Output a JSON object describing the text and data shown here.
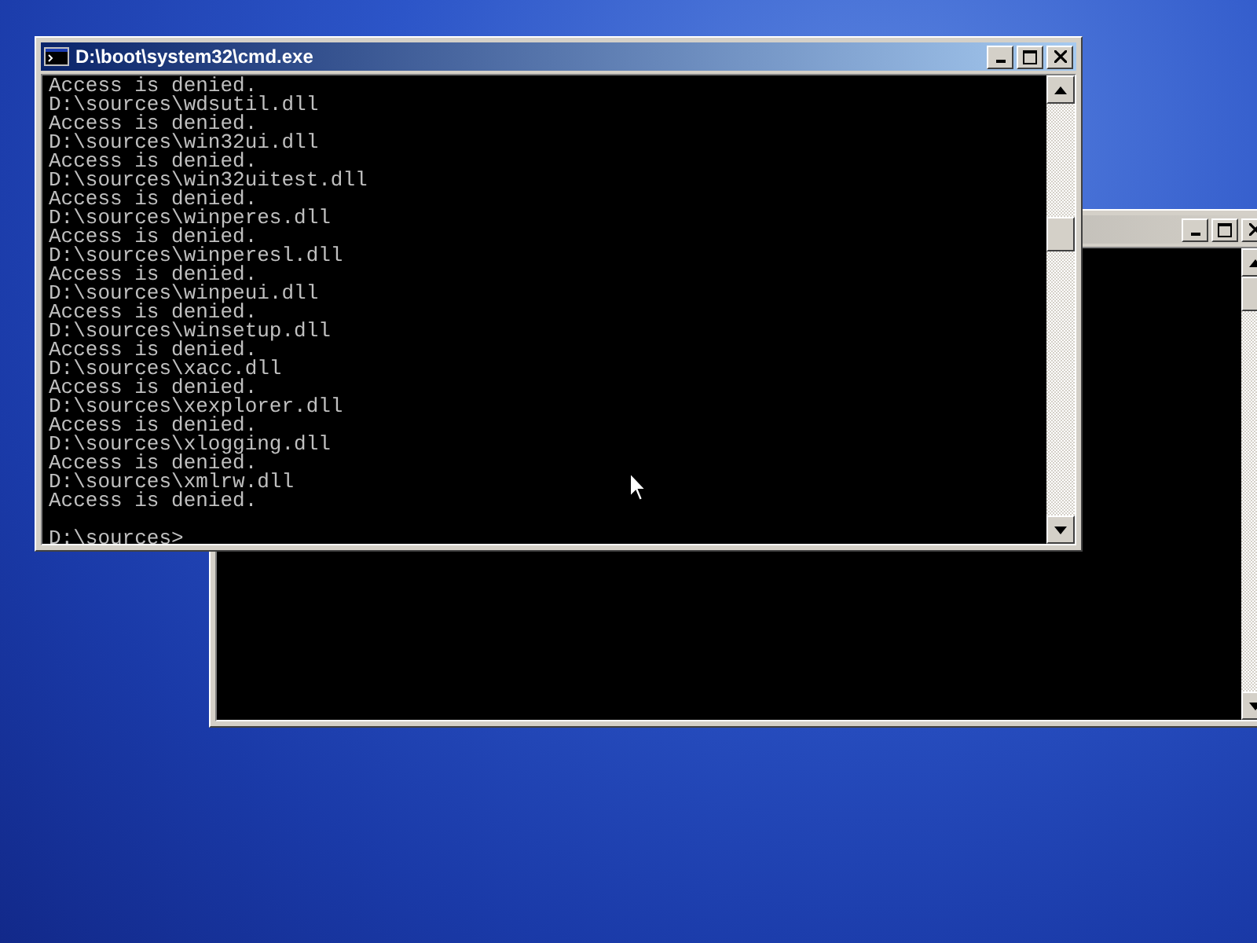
{
  "windows": [
    {
      "active": false
    },
    {
      "active": true,
      "title": "D:\\boot\\system32\\cmd.exe",
      "lines": [
        "Access is denied.",
        "D:\\sources\\wdsutil.dll",
        "Access is denied.",
        "D:\\sources\\win32ui.dll",
        "Access is denied.",
        "D:\\sources\\win32uitest.dll",
        "Access is denied.",
        "D:\\sources\\winperes.dll",
        "Access is denied.",
        "D:\\sources\\winperesl.dll",
        "Access is denied.",
        "D:\\sources\\winpeui.dll",
        "Access is denied.",
        "D:\\sources\\winsetup.dll",
        "Access is denied.",
        "D:\\sources\\xacc.dll",
        "Access is denied.",
        "D:\\sources\\xexplorer.dll",
        "Access is denied.",
        "D:\\sources\\xlogging.dll",
        "Access is denied.",
        "D:\\sources\\xmlrw.dll",
        "Access is denied."
      ],
      "prompt": "D:\\sources>"
    }
  ]
}
